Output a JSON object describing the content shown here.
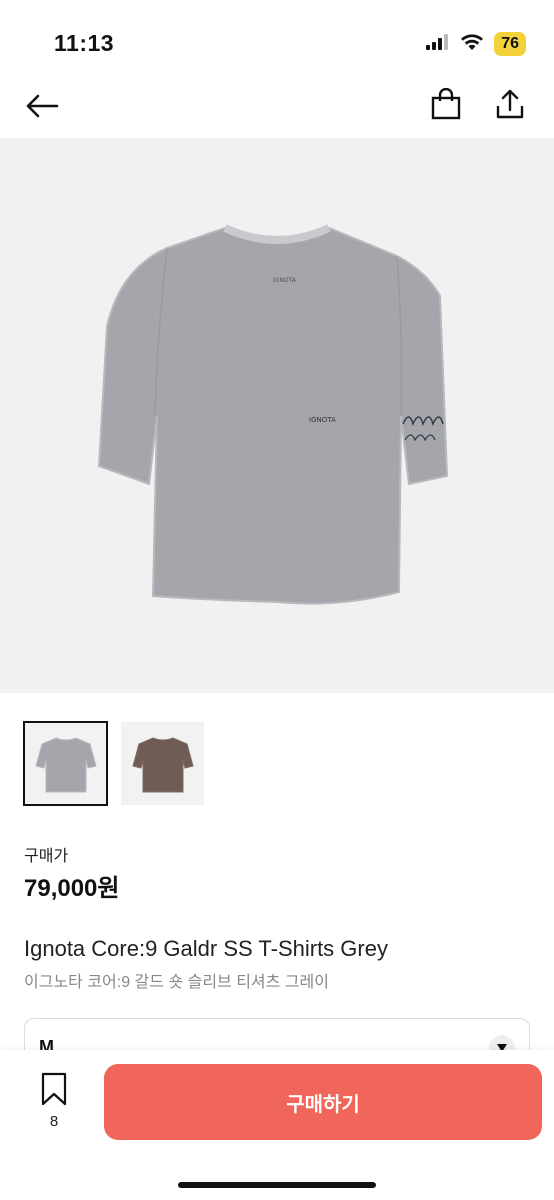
{
  "status_bar": {
    "time": "11:13",
    "battery": "76"
  },
  "product": {
    "price_label": "구매가",
    "price": "79,000원",
    "name": "Ignota Core:9 Galdr SS T-Shirts Grey",
    "name_ko": "이그노타 코어:9 갈드 숏 슬리브 티셔츠 그레이",
    "image_brand_text": "IGNOTA"
  },
  "thumbnails": [
    {
      "color_name": "grey",
      "color": "#a5a6ab",
      "selected": true
    },
    {
      "color_name": "brown",
      "color": "#6f5c54",
      "selected": false
    }
  ],
  "option": {
    "selected": "M"
  },
  "bottom_bar": {
    "bookmark_count": "8",
    "buy_label": "구매하기"
  },
  "colors": {
    "accent": "#f0665a",
    "shirt_grey": "#a5a6ab"
  },
  "icons": {
    "back": "arrow-left-icon",
    "bag": "shopping-bag-icon",
    "share": "share-icon",
    "bookmark": "bookmark-icon",
    "dropdown": "caret-down-icon"
  }
}
